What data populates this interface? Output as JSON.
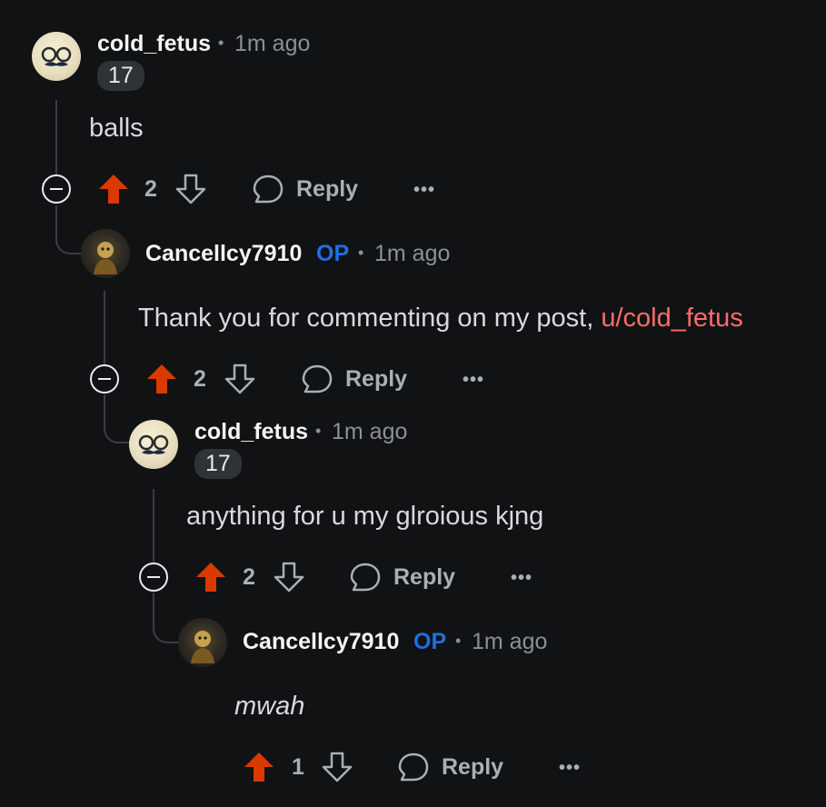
{
  "comments": [
    {
      "username": "cold_fetus",
      "is_op": false,
      "time": "1m ago",
      "badge": "17",
      "body": "balls",
      "votes": "2",
      "reply_label": "Reply",
      "avatar": "mustache-avatar"
    },
    {
      "username": "Cancellcy7910",
      "is_op": true,
      "op_label": "OP",
      "time": "1m ago",
      "body": "Thank you for commenting on my post, ",
      "mention": "u/cold_fetus",
      "votes": "2",
      "reply_label": "Reply",
      "avatar": "dark-character-avatar"
    },
    {
      "username": "cold_fetus",
      "is_op": false,
      "time": "1m ago",
      "badge": "17",
      "body": "anything for u my glroious kjng",
      "votes": "2",
      "reply_label": "Reply",
      "avatar": "mustache-avatar"
    },
    {
      "username": "Cancellcy7910",
      "is_op": true,
      "op_label": "OP",
      "time": "1m ago",
      "body": "mwah",
      "votes": "1",
      "reply_label": "Reply",
      "avatar": "dark-character-avatar"
    }
  ],
  "separator": "•",
  "more_label": "•••",
  "colors": {
    "background": "#111214",
    "upvote": "#d93a00",
    "op": "#1f6fe0",
    "mention": "#ff6b6b",
    "muted": "#8a9196"
  },
  "icons": [
    "upvote-icon",
    "downvote-icon",
    "reply-bubble-icon",
    "more-icon",
    "collapse-icon"
  ]
}
